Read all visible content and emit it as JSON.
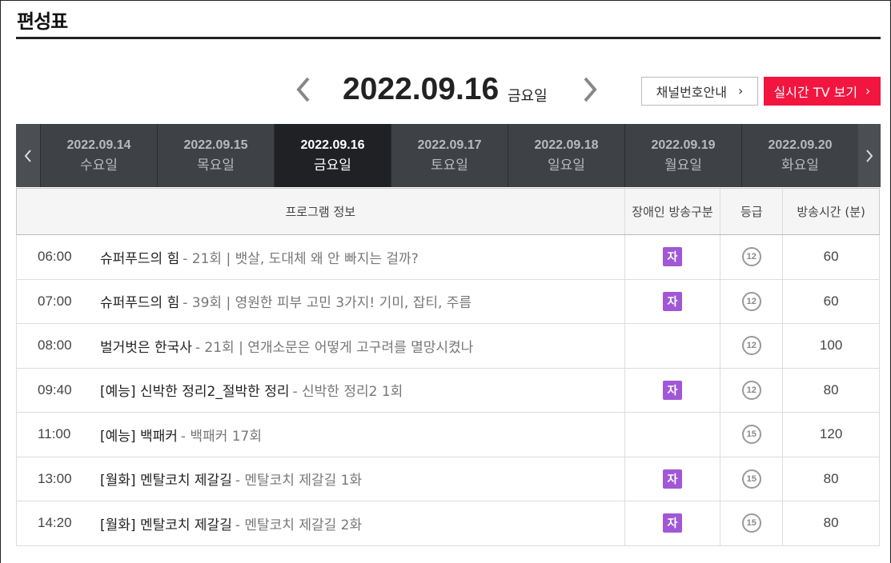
{
  "page": {
    "title": "편성표"
  },
  "date_header": {
    "date": "2022.09.16",
    "day": "금요일",
    "channel_button": "채널번호안내",
    "live_button": "실시간 TV 보기"
  },
  "tabs": [
    {
      "date": "2022.09.14",
      "day": "수요일"
    },
    {
      "date": "2022.09.15",
      "day": "목요일"
    },
    {
      "date": "2022.09.16",
      "day": "금요일"
    },
    {
      "date": "2022.09.17",
      "day": "토요일"
    },
    {
      "date": "2022.09.18",
      "day": "일요일"
    },
    {
      "date": "2022.09.19",
      "day": "월요일"
    },
    {
      "date": "2022.09.20",
      "day": "화요일"
    }
  ],
  "table": {
    "headers": {
      "info": "프로그램 정보",
      "disability": "장애인 방송구분",
      "grade": "등급",
      "duration": "방송시간 (분)"
    },
    "rows": [
      {
        "time": "06:00",
        "name": "슈퍼푸드의 힘",
        "desc": "- 21회 | 뱃살, 도대체 왜 안 빠지는 걸까?",
        "sub": "자",
        "grade": "12",
        "duration": "60"
      },
      {
        "time": "07:00",
        "name": "슈퍼푸드의 힘",
        "desc": "- 39회 | 영원한 피부 고민 3가지! 기미, 잡티, 주름",
        "sub": "자",
        "grade": "12",
        "duration": "60"
      },
      {
        "time": "08:00",
        "name": "벌거벗은 한국사",
        "desc": "- 21회 | 연개소문은 어떻게 고구려를 멸망시켰나",
        "sub": "",
        "grade": "12",
        "duration": "100"
      },
      {
        "time": "09:40",
        "name": "[예능] 신박한 정리2_절박한 정리",
        "desc": "- 신박한 정리2 1회",
        "sub": "자",
        "grade": "12",
        "duration": "80"
      },
      {
        "time": "11:00",
        "name": "[예능] 백패커",
        "desc": "- 백패커 17회",
        "sub": "",
        "grade": "15",
        "duration": "120"
      },
      {
        "time": "13:00",
        "name": "[월화] 멘탈코치 제갈길",
        "desc": "- 멘탈코치 제갈길 1화",
        "sub": "자",
        "grade": "15",
        "duration": "80"
      },
      {
        "time": "14:20",
        "name": "[월화] 멘탈코치 제갈길",
        "desc": "- 멘탈코치 제갈길 2화",
        "sub": "자",
        "grade": "15",
        "duration": "80"
      }
    ]
  },
  "colors": {
    "live_button": "#f2153f",
    "active_tab": "#1f2124",
    "subtitle_badge": "#a058d6"
  }
}
